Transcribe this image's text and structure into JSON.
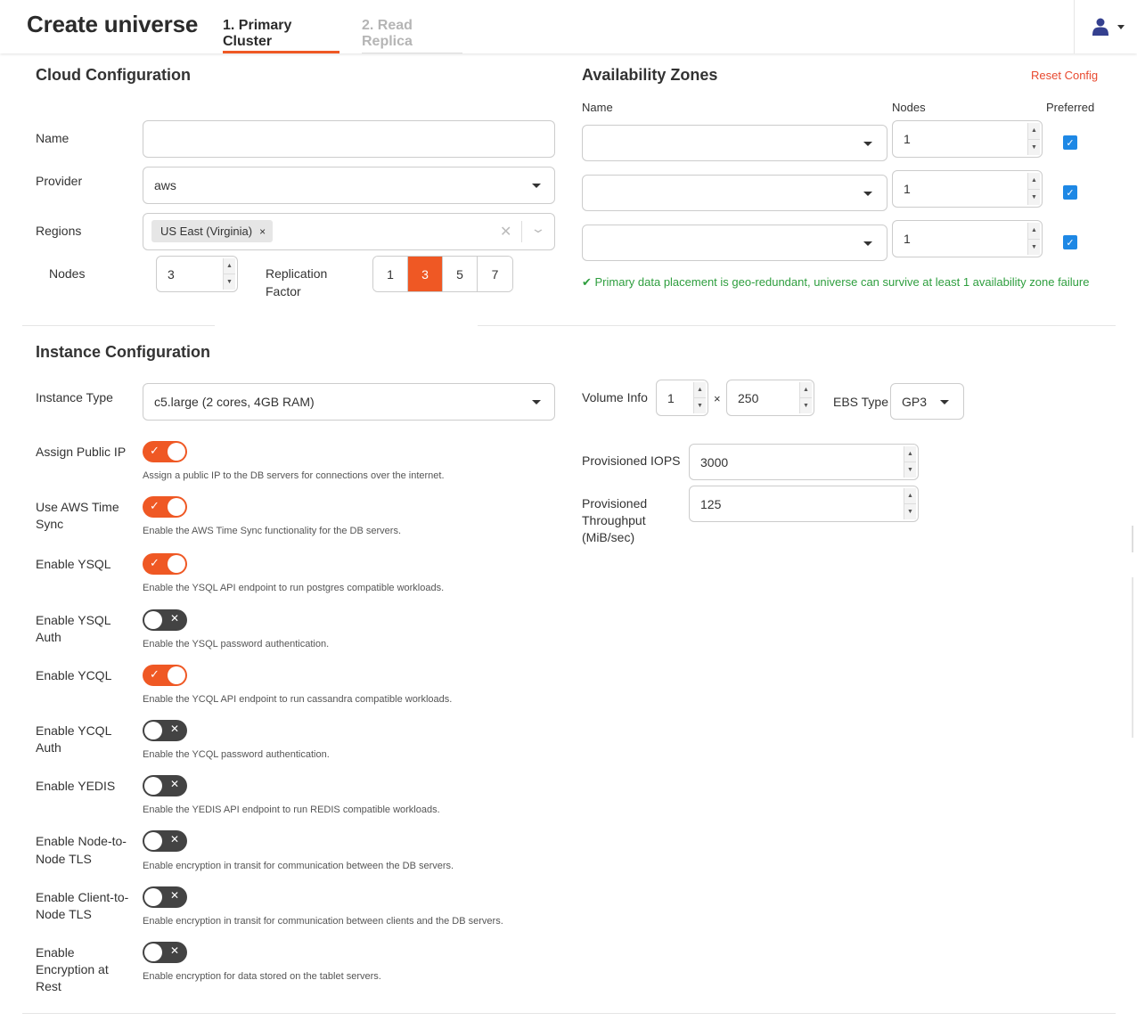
{
  "header": {
    "title": "Create universe",
    "tabs": [
      {
        "label": "1. Primary Cluster",
        "active": true
      },
      {
        "label": "2. Read Replica",
        "active": false
      }
    ]
  },
  "cloud": {
    "title": "Cloud Configuration",
    "name_label": "Name",
    "name_value": "",
    "provider_label": "Provider",
    "provider_value": "aws",
    "regions_label": "Regions",
    "regions_tag": "US East (Virginia)",
    "nodes_label": "Nodes",
    "nodes_value": "3",
    "rf_label_1": "Replication",
    "rf_label_2": "Factor",
    "rf_options": [
      "1",
      "3",
      "5",
      "7"
    ],
    "rf_selected": "3"
  },
  "az": {
    "title": "Availability Zones",
    "reset_label": "Reset Config",
    "col_name": "Name",
    "col_nodes": "Nodes",
    "col_preferred": "Preferred",
    "rows": [
      {
        "name": "",
        "nodes": "1",
        "preferred": true
      },
      {
        "name": "",
        "nodes": "1",
        "preferred": true
      },
      {
        "name": "",
        "nodes": "1",
        "preferred": true
      }
    ],
    "message": "Primary data placement is geo-redundant, universe can survive at least 1 availability zone failure"
  },
  "instance": {
    "title": "Instance Configuration",
    "type_label": "Instance Type",
    "type_value": "c5.large (2 cores, 4GB RAM)",
    "volume_label": "Volume Info",
    "volume_count": "1",
    "volume_times": "×",
    "volume_size": "250",
    "ebs_label": "EBS Type",
    "ebs_value": "GP3",
    "iops_label": "Provisioned IOPS",
    "iops_value": "3000",
    "throughput_label_1": "Provisioned",
    "throughput_label_2": "Throughput",
    "throughput_label_3": "(MiB/sec)",
    "throughput_value": "125",
    "toggles": [
      {
        "label1": "Assign Public IP",
        "label2": "",
        "help": "Assign a public IP to the DB servers for connections over the internet.",
        "on": true
      },
      {
        "label1": "Use AWS Time",
        "label2": "Sync",
        "help": "Enable the AWS Time Sync functionality for the DB servers.",
        "on": true
      },
      {
        "label1": "Enable YSQL",
        "label2": "",
        "help": "Enable the YSQL API endpoint to run postgres compatible workloads.",
        "on": true
      },
      {
        "label1": "Enable YSQL",
        "label2": "Auth",
        "help": "Enable the YSQL password authentication.",
        "on": false
      },
      {
        "label1": "Enable YCQL",
        "label2": "",
        "help": "Enable the YCQL API endpoint to run cassandra compatible workloads.",
        "on": true
      },
      {
        "label1": "Enable YCQL",
        "label2": "Auth",
        "help": "Enable the YCQL password authentication.",
        "on": false
      },
      {
        "label1": "Enable YEDIS",
        "label2": "",
        "help": "Enable the YEDIS API endpoint to run REDIS compatible workloads.",
        "on": false
      },
      {
        "label1": "Enable Node-to-",
        "label2": "Node TLS",
        "help": "Enable encryption in transit for communication between the DB servers.",
        "on": false
      },
      {
        "label1": "Enable Client-to-",
        "label2": "Node TLS",
        "help": "Enable encryption in transit for communication between clients and the DB servers.",
        "on": false
      },
      {
        "label1": "Enable",
        "label2": "Encryption at",
        "label3": "Rest",
        "help": "Enable encryption for data stored on the tablet servers.",
        "on": false
      }
    ]
  },
  "colors": {
    "accent": "#ef5824",
    "checkbox": "#1e88e5",
    "success": "#2e9e3e",
    "reset": "#e8492f"
  }
}
